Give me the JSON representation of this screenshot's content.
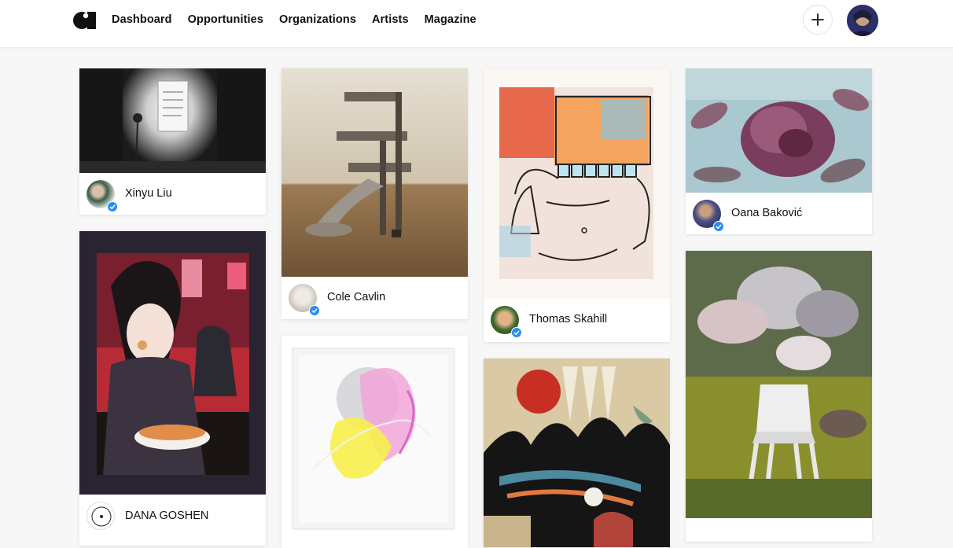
{
  "nav": {
    "logo": "brand-logo",
    "items": [
      "Dashboard",
      "Opportunities",
      "Organizations",
      "Artists",
      "Magazine"
    ],
    "actions": {
      "create_icon": "plus-icon",
      "profile_icon": "user-avatar"
    }
  },
  "colors": {
    "accent": "#2d8cf0",
    "background": "#f7f7f7",
    "card": "#ffffff",
    "text": "#111111"
  },
  "feed": {
    "columns": [
      {
        "cards": [
          {
            "artist": "Xinyu Liu",
            "verified": true
          },
          {
            "artist": "DANA GOSHEN",
            "verified": false
          }
        ]
      },
      {
        "cards": [
          {
            "artist": "Cole Cavlin",
            "verified": true
          },
          {
            "artist": "",
            "verified": false
          }
        ]
      },
      {
        "cards": [
          {
            "artist": "Thomas Skahill",
            "verified": true
          },
          {
            "artist": "",
            "verified": false
          }
        ]
      },
      {
        "cards": [
          {
            "artist": "Oana Baković",
            "verified": true
          },
          {
            "artist": "",
            "verified": false
          }
        ]
      }
    ]
  }
}
